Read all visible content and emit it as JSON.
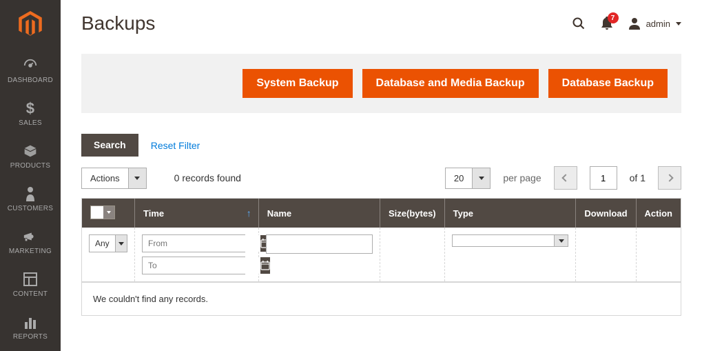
{
  "sidebar": {
    "items": [
      {
        "label": "DASHBOARD"
      },
      {
        "label": "SALES"
      },
      {
        "label": "PRODUCTS"
      },
      {
        "label": "CUSTOMERS"
      },
      {
        "label": "MARKETING"
      },
      {
        "label": "CONTENT"
      },
      {
        "label": "REPORTS"
      }
    ]
  },
  "header": {
    "title": "Backups",
    "notification_count": "7",
    "username": "admin"
  },
  "buttons": {
    "system_backup": "System Backup",
    "db_media_backup": "Database and Media Backup",
    "db_backup": "Database Backup"
  },
  "filter": {
    "search_label": "Search",
    "reset_label": "Reset Filter"
  },
  "toolbar": {
    "actions_label": "Actions",
    "records_text": "0 records found",
    "page_size": "20",
    "per_page_label": "per page",
    "current_page": "1",
    "total_pages": "of 1"
  },
  "table": {
    "headers": {
      "time": "Time",
      "name": "Name",
      "size": "Size(bytes)",
      "type": "Type",
      "download": "Download",
      "action": "Action"
    },
    "filters": {
      "any_label": "Any",
      "from_placeholder": "From",
      "to_placeholder": "To"
    },
    "empty_message": "We couldn't find any records."
  }
}
